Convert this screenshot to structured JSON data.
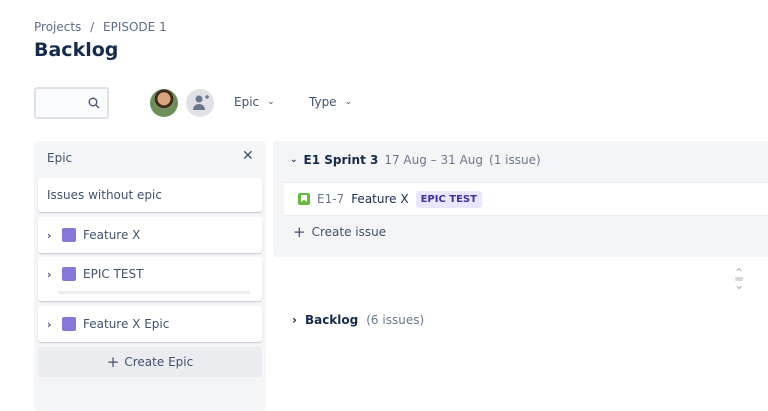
{
  "breadcrumb": {
    "projects": "Projects",
    "separator": "/",
    "project": "EPISODE 1"
  },
  "page_title": "Backlog",
  "toolbar": {
    "search_placeholder": "",
    "epic_filter": "Epic",
    "type_filter": "Type"
  },
  "epic_panel": {
    "title": "Epic",
    "issues_without_epic": "Issues without epic",
    "epics": [
      {
        "name": "Feature X",
        "color": "#8777d9"
      },
      {
        "name": "EPIC TEST",
        "color": "#8777d9",
        "progress": 0
      },
      {
        "name": "Feature X Epic",
        "color": "#8777d9"
      }
    ],
    "create_epic": "Create Epic"
  },
  "sprint": {
    "name": "E1 Sprint 3",
    "dates": "17 Aug – 31 Aug",
    "count": "(1 issue)",
    "issues": [
      {
        "key": "E1-7",
        "summary": "Feature X",
        "epic": "EPIC TEST"
      }
    ],
    "create_issue": "Create issue"
  },
  "backlog": {
    "name": "Backlog",
    "count": "(6 issues)"
  }
}
